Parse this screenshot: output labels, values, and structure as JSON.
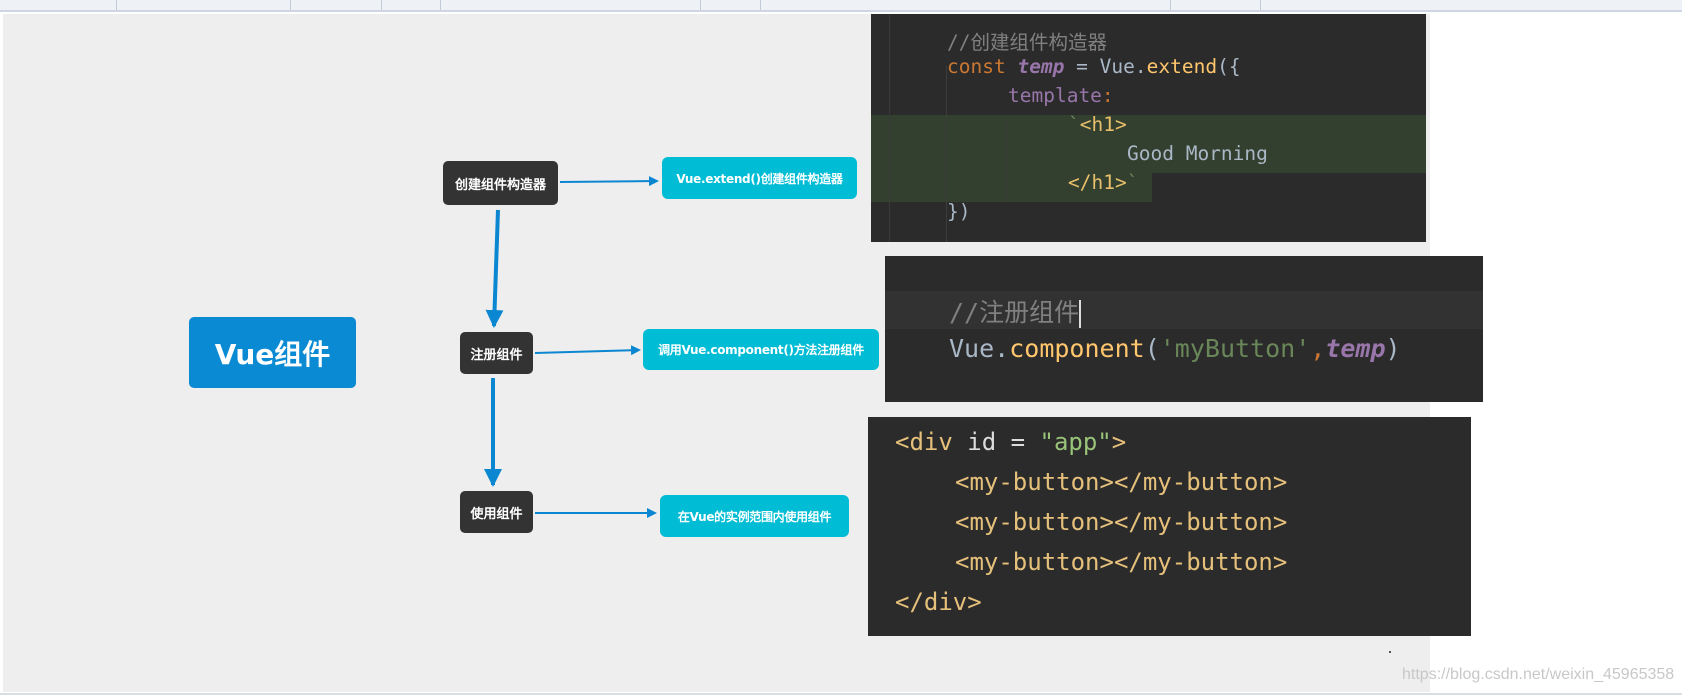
{
  "diagram": {
    "root": "Vue组件",
    "steps": [
      "创建组件构造器",
      "注册组件",
      "使用组件"
    ],
    "notes": [
      "Vue.extend()创建组件构造器",
      "调用Vue.component()方法注册组件",
      "在Vue的实例范围内使用组件"
    ]
  },
  "code_extend": {
    "comment": "//创建组件构造器",
    "kw_const": "const",
    "var_temp": "temp",
    "eq": " = ",
    "vue": "Vue.",
    "extend": "extend",
    "open": "({",
    "template": "template",
    "colon": ":",
    "tick": "`",
    "h1_open": "<h1>",
    "text": "Good Morning",
    "h1_close": "</h1>",
    "close": "})"
  },
  "code_register": {
    "comment": "//注册组件",
    "vue": "Vue.",
    "component": "component",
    "paren_open": "(",
    "name": "'myButton'",
    "comma": ",",
    "arg": "temp",
    "paren_close": ")"
  },
  "code_html": {
    "div_open_start": "<div ",
    "div_attr": "id = ",
    "div_attr_value": "\"app\"",
    "div_open_end": ">",
    "my_button": "<my-button></my-button>",
    "div_close": "</div>"
  },
  "watermark": "https://blog.csdn.net/weixin_45965358",
  "colors": {
    "root": "#0b8ad4",
    "step": "#333333",
    "note": "#00bcd4",
    "arrow": "#0b86d1",
    "code_bg": "#2b2b2b"
  }
}
